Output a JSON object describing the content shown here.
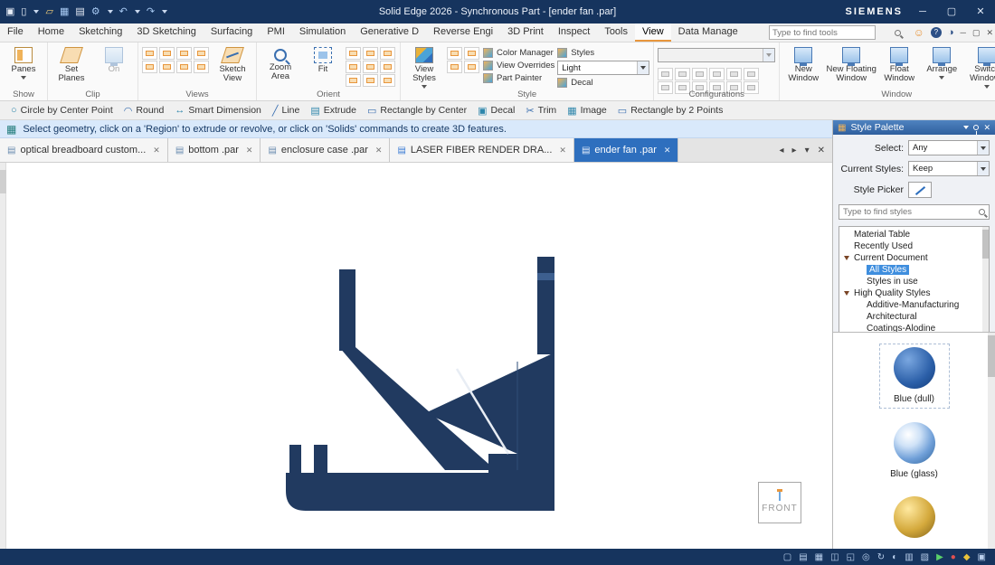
{
  "colors": {
    "titlebar": "#16345e",
    "accent_orange": "#e8963c",
    "active_tab_blue": "#2e6fbe",
    "prompt_bg": "#d9e9fb",
    "selection_blue": "#3f8ede",
    "model": "#213a60"
  },
  "icons": {
    "app": "▣",
    "new": "▯",
    "open": "▱",
    "save": "▦",
    "print": "▤",
    "settings": "⚙",
    "undo": "↶",
    "redo": "↷",
    "select": "▢",
    "smiley": "☺",
    "help": "?",
    "theme": "◑",
    "min": "─",
    "restore": "▢",
    "close": "✕",
    "tab_left": "◂",
    "tab_right": "▸",
    "tab_caret": "▾",
    "doc": "▤",
    "prompt": "▦",
    "palette": "▦"
  },
  "title_bar": {
    "title": "Solid Edge 2026 - Synchronous Part - [ender fan .par]",
    "brand": "SIEMENS"
  },
  "tabs_row": {
    "tabs": [
      "File",
      "Home",
      "Sketching",
      "3D Sketching",
      "Surfacing",
      "PMI",
      "Simulation",
      "Generative D",
      "Reverse Engi",
      "3D Print",
      "Inspect",
      "Tools",
      "View",
      "Data Manage"
    ],
    "active": "View"
  },
  "search": {
    "tools_placeholder": "Type to find tools",
    "styles_placeholder": "Type to find styles"
  },
  "ribbon": {
    "show": {
      "label": "Show",
      "panes": "Panes"
    },
    "clip": {
      "label": "Clip",
      "set_planes": "Set Planes",
      "on": "On"
    },
    "views": {
      "label": "Views",
      "sketch_view": "Sketch View"
    },
    "orient": {
      "label": "Orient",
      "zoom_area": "Zoom Area",
      "fit": "Fit"
    },
    "style": {
      "label": "Style",
      "view_styles": "View Styles",
      "color_manager": "Color Manager",
      "view_overrides": "View Overrides",
      "part_painter": "Part Painter",
      "styles": "Styles",
      "light": "Light",
      "decal": "Decal"
    },
    "configurations": {
      "label": "Configurations"
    },
    "window": {
      "label": "Window",
      "new_window": "New Window",
      "new_floating": "New Floating Window",
      "float_window": "Float Window",
      "arrange": "Arrange",
      "switch_windows": "Switch Windows"
    }
  },
  "command_bar": {
    "items": [
      {
        "glyph": "○",
        "label": "Circle by Center Point"
      },
      {
        "glyph": "◠",
        "label": "Round"
      },
      {
        "glyph": "↔",
        "label": "Smart Dimension"
      },
      {
        "glyph": "╱",
        "label": "Line"
      },
      {
        "glyph": "▤",
        "label": "Extrude"
      },
      {
        "glyph": "▭",
        "label": "Rectangle by Center"
      },
      {
        "glyph": "▣",
        "label": "Decal"
      },
      {
        "glyph": "✂",
        "label": "Trim"
      },
      {
        "glyph": "▦",
        "label": "Image"
      },
      {
        "glyph": "▭",
        "label": "Rectangle by 2 Points"
      }
    ]
  },
  "prompt_bar": {
    "text": "Select geometry, click on a 'Region' to extrude or revolve, or click on 'Solids' commands to create 3D features."
  },
  "document_tabs": {
    "tabs": [
      {
        "label": "optical breadboard custom..."
      },
      {
        "label": "bottom .par"
      },
      {
        "label": "enclosure case .par"
      },
      {
        "label": "LASER FIBER RENDER DRA..."
      },
      {
        "label": "ender fan .par"
      }
    ]
  },
  "canvas": {
    "front_label": "FRONT",
    "model_color": "#213a60"
  },
  "style_palette": {
    "title": "Style Palette",
    "select_label": "Select:",
    "select_value": "Any",
    "current_styles_label": "Current Styles:",
    "current_styles_value": "Keep",
    "style_picker_label": "Style Picker",
    "tree": [
      {
        "label": "Material Table"
      },
      {
        "label": "Recently Used"
      },
      {
        "label": "Current Document"
      },
      {
        "label": "All Styles"
      },
      {
        "label": "Styles in use"
      },
      {
        "label": "High Quality Styles"
      },
      {
        "label": "Additive-Manufacturing"
      },
      {
        "label": "Architectural"
      },
      {
        "label": "Coatings-Alodine"
      }
    ],
    "swatches": [
      {
        "label": "Blue (dull)"
      },
      {
        "label": "Blue (glass)"
      },
      {
        "label": ""
      }
    ]
  },
  "status_bar": {
    "icons": [
      {
        "glyph": "▢"
      },
      {
        "glyph": "▤"
      },
      {
        "glyph": "▦"
      },
      {
        "glyph": "◫"
      },
      {
        "glyph": "◱"
      },
      {
        "glyph": "◎"
      },
      {
        "glyph": "↻"
      },
      {
        "glyph": "◐"
      },
      {
        "glyph": "▥"
      },
      {
        "glyph": "▧"
      },
      {
        "glyph": "▶"
      },
      {
        "glyph": "●"
      },
      {
        "glyph": "◆"
      },
      {
        "glyph": "▣"
      }
    ]
  }
}
